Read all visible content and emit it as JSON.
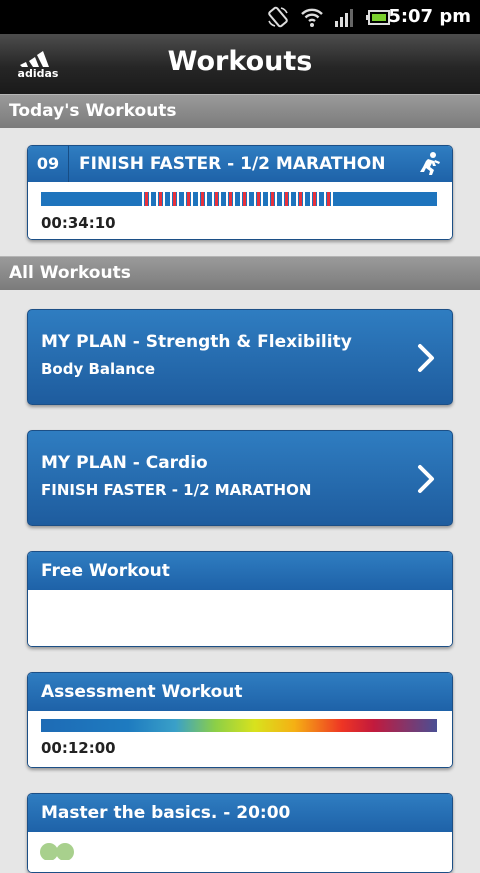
{
  "status_bar": {
    "time": "5:07 pm"
  },
  "header": {
    "title": "Workouts",
    "logo_text": "adidas"
  },
  "sections": {
    "today": "Today's Workouts",
    "all": "All Workouts"
  },
  "today_workout": {
    "number": "09",
    "title": "FINISH FASTER - 1/2 MARATHON",
    "duration": "00:34:10"
  },
  "plans": [
    {
      "title": "MY PLAN - Strength & Flexibility",
      "subtitle": "Body Balance"
    },
    {
      "title": "MY PLAN - Cardio",
      "subtitle": "FINISH FASTER - 1/2 MARATHON"
    }
  ],
  "free_workout": {
    "title": "Free Workout"
  },
  "assessment_workout": {
    "title": "Assessment Workout",
    "duration": "00:12:00"
  },
  "master_basics": {
    "title": "Master the basics. - 20:00"
  },
  "colors": {
    "brand_blue": "#1e62a8",
    "interval_red": "#e8323c",
    "section_gray": "#8a8a8a"
  }
}
